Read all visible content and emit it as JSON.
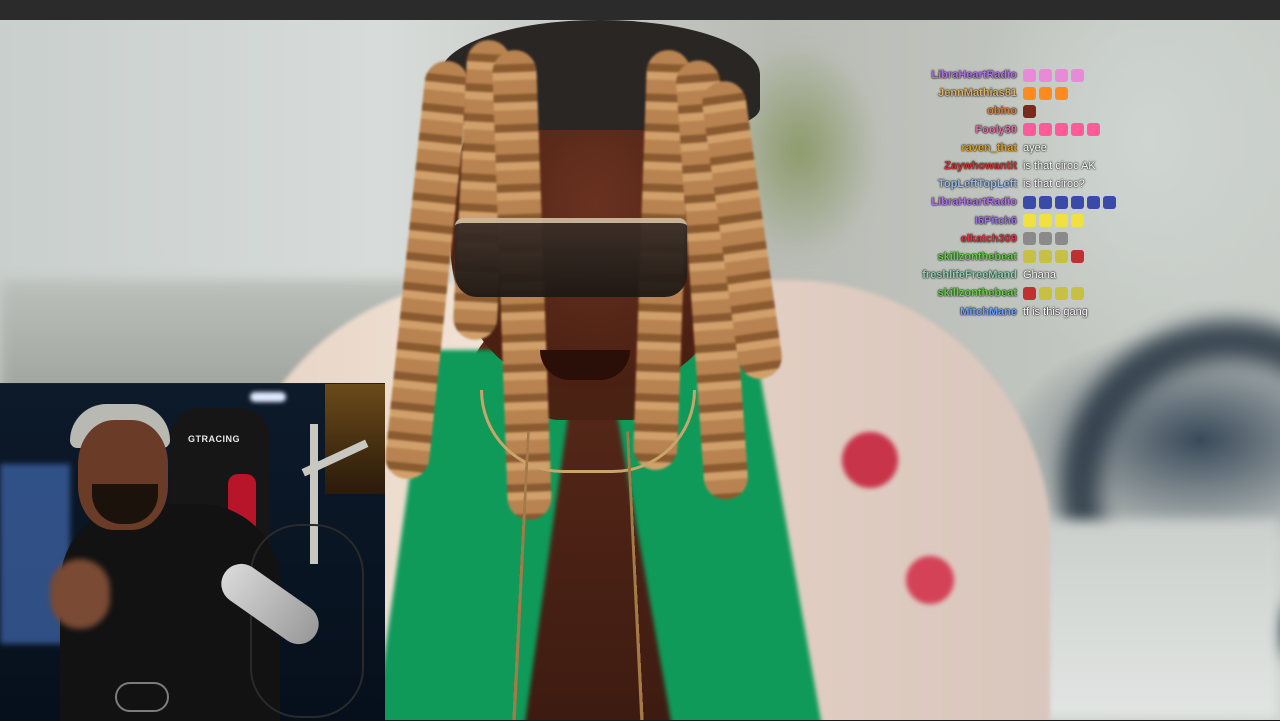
{
  "stream": {
    "webcam_chair_brand": "GTRACING"
  },
  "chat": {
    "messages": [
      {
        "user": "LibraHeartRadio",
        "user_color": "#b06fe8",
        "text": "",
        "emotes": [
          "#e88ad8",
          "#e88ad8",
          "#e88ad8",
          "#e88ad8"
        ]
      },
      {
        "user": "JennMathias81",
        "user_color": "#e0b060",
        "text": "",
        "emotes": [
          "#ff8a20",
          "#ff8a20",
          "#ff8a20"
        ]
      },
      {
        "user": "obino",
        "user_color": "#e07a38",
        "text": "",
        "emotes": [
          "#7a2a1a"
        ]
      },
      {
        "user": "Fooly30",
        "user_color": "#e06aa0",
        "text": "",
        "emotes": [
          "#ff5a9a",
          "#ff5a9a",
          "#ff5a9a",
          "#ff5a9a",
          "#ff5a9a"
        ]
      },
      {
        "user": "raven_that",
        "user_color": "#e0a020",
        "text": "ayee",
        "emotes": []
      },
      {
        "user": "Zaywhowantit",
        "user_color": "#d03030",
        "text": "is that ciroc AK",
        "emotes": []
      },
      {
        "user": "TopLeftTopLeft",
        "user_color": "#9ab8e8",
        "text": "is that ciroc?",
        "emotes": []
      },
      {
        "user": "LibraHeartRadio",
        "user_color": "#b06fe8",
        "text": "",
        "emotes": [
          "#3a4aa8",
          "#3a4aa8",
          "#3a4aa8",
          "#3a4aa8",
          "#3a4aa8",
          "#3a4aa8"
        ]
      },
      {
        "user": "I6Pitch6",
        "user_color": "#a070e8",
        "text": "",
        "emotes": [
          "#f0e040",
          "#f0e040",
          "#f0e040",
          "#f0e040"
        ]
      },
      {
        "user": "elkatch309",
        "user_color": "#e03040",
        "text": "",
        "emotes": [
          "#8a8a8a",
          "#8a8a8a",
          "#8a8a8a"
        ]
      },
      {
        "user": "skillzonthebeat",
        "user_color": "#60d040",
        "text": "",
        "emotes": [
          "#c8c040",
          "#c8c040",
          "#c8c040",
          "#c03030"
        ]
      },
      {
        "user": "freshlifeFreeMand",
        "user_color": "#8fd0b0",
        "text": "Ghana",
        "emotes": []
      },
      {
        "user": "skillzonthebeat",
        "user_color": "#60d040",
        "text": "",
        "emotes": [
          "#c03030",
          "#c8c040",
          "#c8c040",
          "#c8c040"
        ]
      },
      {
        "user": "MitchMane",
        "user_color": "#6aa0ff",
        "text": "tf is this gang",
        "emotes": []
      }
    ]
  }
}
